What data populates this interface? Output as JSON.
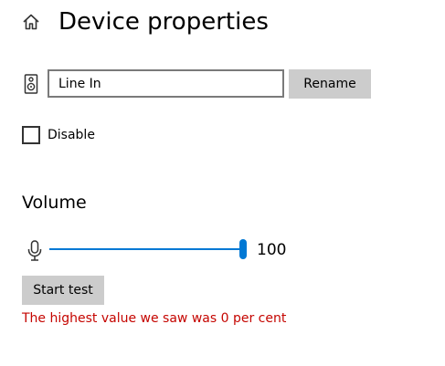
{
  "header": {
    "title": "Device properties",
    "home_icon": "home-icon"
  },
  "device": {
    "icon": "speaker-icon",
    "name_value": "Line In",
    "rename_label": "Rename"
  },
  "disable": {
    "label": "Disable",
    "checked": false
  },
  "volume": {
    "heading": "Volume",
    "icon": "microphone-icon",
    "level": 100,
    "level_text": "100",
    "start_test_label": "Start test",
    "result_text": "The highest value we saw was 0 per cent"
  },
  "colors": {
    "accent": "#0078d4",
    "error": "#c50500",
    "button_bg": "#cccccc"
  }
}
